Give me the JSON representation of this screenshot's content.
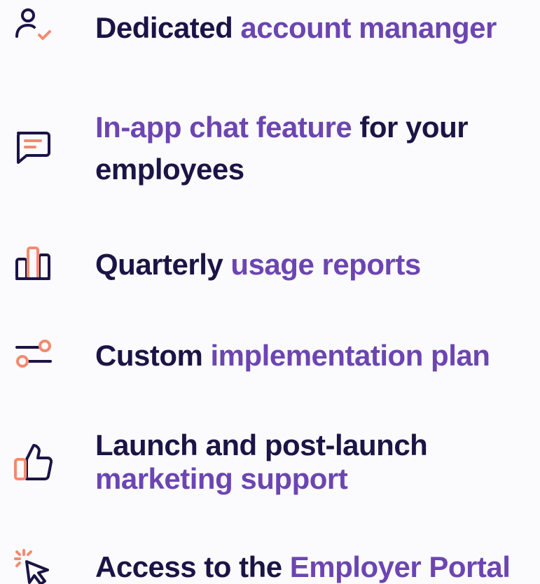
{
  "colors": {
    "dark": "#1b1446",
    "accent": "#6c45b2",
    "icon_highlight": "#f28a70",
    "background": "#fbfbfd"
  },
  "features": [
    {
      "icon": "user-check-icon",
      "line1": {
        "dark": "Dedicated ",
        "accent": "account mananger"
      }
    },
    {
      "icon": "chat-bubble-icon",
      "line1": {
        "accent": "In-app chat feature",
        "dark": " for your"
      },
      "line2": {
        "dark": "employees"
      }
    },
    {
      "icon": "bar-chart-icon",
      "line1": {
        "dark": "Quarterly ",
        "accent": "usage reports"
      }
    },
    {
      "icon": "sliders-icon",
      "line1": {
        "dark": "Custom ",
        "accent": "implementation plan"
      }
    },
    {
      "icon": "thumbs-up-icon",
      "line1": {
        "dark": "Launch and post-launch"
      },
      "line2": {
        "accent": "marketing support"
      }
    },
    {
      "icon": "cursor-click-icon",
      "line1": {
        "dark": "Access to the ",
        "accent": "Employer Portal"
      }
    }
  ]
}
